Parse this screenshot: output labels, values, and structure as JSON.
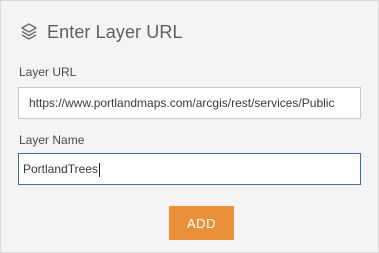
{
  "dialog": {
    "title": "Enter Layer URL",
    "title_icon": "layers-icon"
  },
  "layer_url": {
    "label": "Layer URL",
    "value": "https://www.portlandmaps.com/arcgis/rest/services/Public"
  },
  "layer_name": {
    "label": "Layer Name",
    "value": "PortlandTrees"
  },
  "actions": {
    "add_label": "ADD"
  },
  "colors": {
    "accent": "#e8913a",
    "panel_bg": "#f4f4f4",
    "focus_border": "#3d6ea8",
    "text_muted": "#5f5f5f"
  }
}
